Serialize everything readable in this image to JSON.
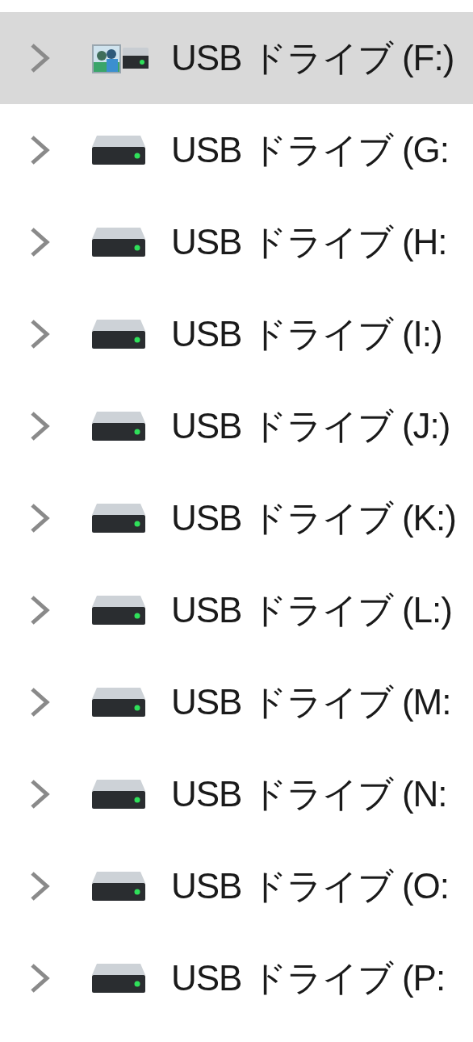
{
  "navigation_pane": {
    "items": [
      {
        "label": "USB ドライブ (F:)",
        "kind": "media",
        "selected": true
      },
      {
        "label": "USB ドライブ (G:",
        "kind": "drive",
        "selected": false
      },
      {
        "label": "USB ドライブ (H:",
        "kind": "drive",
        "selected": false
      },
      {
        "label": "USB ドライブ (I:)",
        "kind": "drive",
        "selected": false
      },
      {
        "label": "USB ドライブ (J:)",
        "kind": "drive",
        "selected": false
      },
      {
        "label": "USB ドライブ (K:)",
        "kind": "drive",
        "selected": false
      },
      {
        "label": "USB ドライブ (L:)",
        "kind": "drive",
        "selected": false
      },
      {
        "label": "USB ドライブ (M:",
        "kind": "drive",
        "selected": false
      },
      {
        "label": "USB ドライブ (N:",
        "kind": "drive",
        "selected": false
      },
      {
        "label": "USB ドライブ (O:",
        "kind": "drive",
        "selected": false
      },
      {
        "label": "USB ドライブ (P:",
        "kind": "drive",
        "selected": false
      }
    ]
  }
}
